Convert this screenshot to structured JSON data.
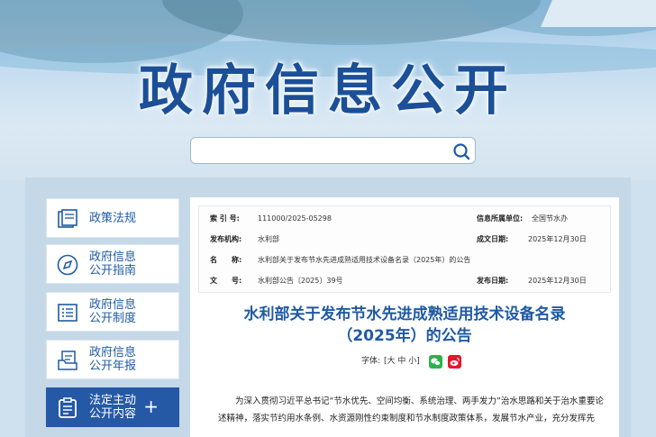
{
  "banner": {
    "title": "政府信息公开",
    "search_placeholder": ""
  },
  "nav": {
    "items": [
      {
        "label": "政策法规",
        "icon": "book-icon"
      },
      {
        "label": "政府信息\n公开指南",
        "icon": "compass-icon"
      },
      {
        "label": "政府信息\n公开制度",
        "icon": "list-icon"
      },
      {
        "label": "政府信息\n公开年报",
        "icon": "document-stack-icon"
      },
      {
        "label": "法定主动\n公开内容",
        "icon": "clipboard-icon",
        "active": true
      }
    ],
    "plus": "+"
  },
  "meta": {
    "index_label": "索 引 号:",
    "index_value": "111000/2025-05298",
    "unit_label": "信息所属单位:",
    "unit_value": "全国节水办",
    "issuer_label": "发布机构:",
    "issuer_value": "水利部",
    "date_label": "成文日期:",
    "date_value": "2025年12月30日",
    "name_label": "名　　称:",
    "name_value": "水利部关于发布节水先进成熟适用技术设备名录（2025年）的公告",
    "docno_label": "文　　号:",
    "docno_value": "水利部公告〔2025〕39号",
    "pubdate_label": "发布日期:",
    "pubdate_value": "2025年12月30日"
  },
  "document": {
    "title_line1": "水利部关于发布节水先进成熟适用技术设备名录",
    "title_line2": "（2025年）的公告",
    "font_label": "字体:",
    "font_sizes": "[大 中 小]",
    "body": "为深入贯彻习近平总书记“节水优先、空间均衡、系统治理、两手发力”治水思路和关于治水重要论述精神，落实节约用水条例、水资源刚性约束制度和节水制度政策体系，发展节水产业，充分发挥先"
  },
  "colors": {
    "brand_blue": "#1f5aa5",
    "active_nav": "#2559a6",
    "wechat": "#2bb24c",
    "weibo": "#e6162d"
  }
}
